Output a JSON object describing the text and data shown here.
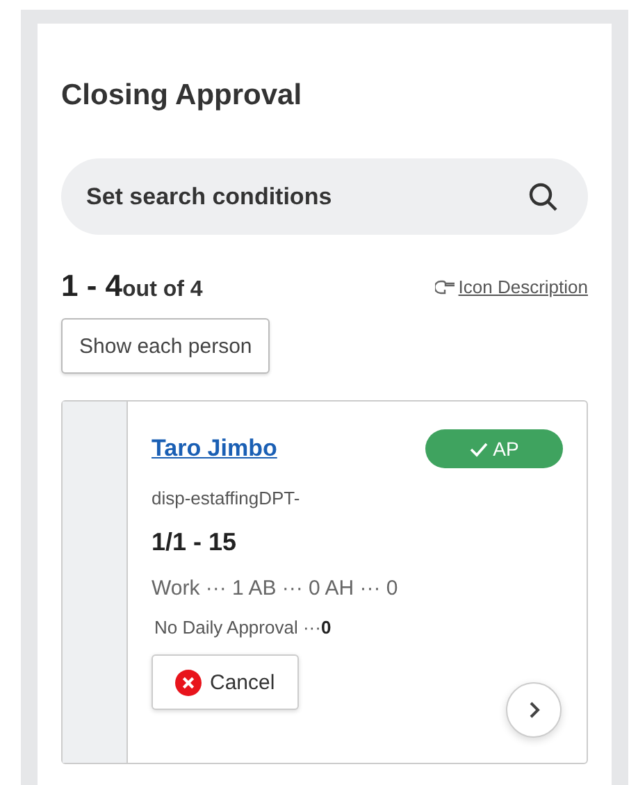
{
  "title": "Closing Approval",
  "search": {
    "placeholder": "Set search conditions"
  },
  "count": {
    "range": "1 - 4",
    "total": "out of 4"
  },
  "icon_description_link": "Icon Description",
  "show_each_button": "Show each person",
  "cards": [
    {
      "name": "Taro Jimbo",
      "status": {
        "kind": "approved",
        "label": "AP"
      },
      "department": "disp-estaffingDPT-",
      "period": "1/1 - 15",
      "summary": "Work ··· 1 AB ··· 0 AH ··· 0",
      "daily": "No Daily Approval ···**0**",
      "cancel_button": "Cancel"
    }
  ]
}
